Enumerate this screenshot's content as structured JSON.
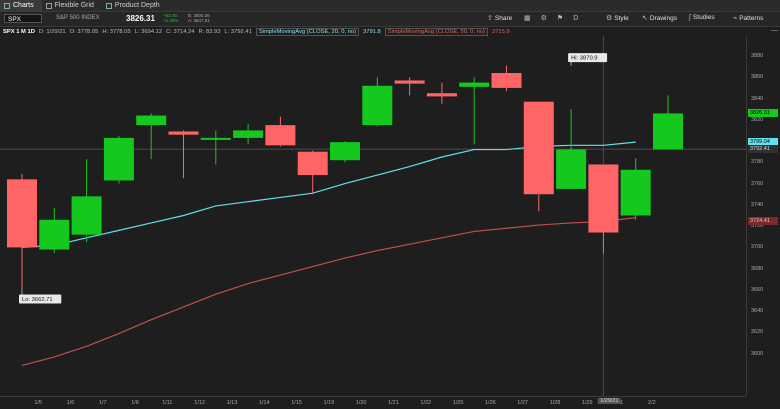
{
  "tabs": [
    {
      "label": "Charts",
      "active": true
    },
    {
      "label": "Flexible Grid",
      "active": false
    },
    {
      "label": "Product Depth",
      "active": false
    }
  ],
  "toolbar": {
    "symbol": "SPX",
    "symbol_name": "S&P 500 INDEX",
    "last": "3826.31",
    "change_abs": "+52.45",
    "change_pct": "+1.39%",
    "bid": "B: 3805.36",
    "ask": "A: 3847.61",
    "share_label": "Share",
    "aggregation_label": "D",
    "style_label": "Style",
    "drawings_label": "Drawings",
    "studies_label": "Studies",
    "patterns_label": "Patterns"
  },
  "study_line": {
    "symbol_period": "SPX 1 M 1D",
    "date": "D: 1/29/21",
    "open": "O: 3778.05",
    "high": "H: 3778.05",
    "low": "L: 3694.12",
    "close": "C: 3714.24",
    "range": "R: 83.93",
    "last": "L: 3792.41",
    "sma20_label": "SimpleMovingAvg (CLOSE, 20, 0, no)",
    "sma20_value": "3791.8",
    "sma50_label": "SimpleMovingAvg (CLOSE, 50, 0, no)",
    "sma50_value": "3715.9"
  },
  "price_badges": {
    "last": "3826.31",
    "sma20": "3799.04",
    "crosshair": "3792.41",
    "sma50": "3724.41"
  },
  "colors": {
    "up": "#14c81e",
    "down": "#ff6565",
    "sma20": "#5ee2ec",
    "sma50": "#c0504d"
  },
  "chart_data": {
    "type": "candlestick",
    "ylim": [
      3580,
      3880
    ],
    "yticks": [
      3600,
      3620,
      3640,
      3660,
      3680,
      3700,
      3720,
      3740,
      3760,
      3780,
      3800,
      3820,
      3840,
      3860,
      3880
    ],
    "xticks": [
      "1/5",
      "1/6",
      "1/7",
      "1/8",
      "1/11",
      "1/12",
      "1/13",
      "1/14",
      "1/15",
      "1/19",
      "1/20",
      "1/21",
      "1/22",
      "1/25",
      "1/26",
      "1/27",
      "1/28",
      "1/29",
      "2/1",
      "2/2"
    ],
    "candles": [
      {
        "o": 3764,
        "h": 3769,
        "l": 3662.71,
        "c": 3700
      },
      {
        "o": 3698,
        "h": 3737,
        "l": 3695,
        "c": 3726
      },
      {
        "o": 3712,
        "h": 3783,
        "l": 3705,
        "c": 3748
      },
      {
        "o": 3763,
        "h": 3805,
        "l": 3760,
        "c": 3803
      },
      {
        "o": 3815,
        "h": 3826,
        "l": 3783,
        "c": 3824
      },
      {
        "o": 3809,
        "h": 3810,
        "l": 3765,
        "c": 3806
      },
      {
        "o": 3803,
        "h": 3810,
        "l": 3778,
        "c": 3803
      },
      {
        "o": 3803,
        "h": 3816,
        "l": 3797,
        "c": 3810
      },
      {
        "o": 3815,
        "h": 3823,
        "l": 3795,
        "c": 3796
      },
      {
        "o": 3790,
        "h": 3791,
        "l": 3750,
        "c": 3768
      },
      {
        "o": 3782,
        "h": 3800,
        "l": 3780,
        "c": 3799
      },
      {
        "o": 3815,
        "h": 3860,
        "l": 3814,
        "c": 3852
      },
      {
        "o": 3857,
        "h": 3860,
        "l": 3843,
        "c": 3854
      },
      {
        "o": 3845,
        "h": 3855,
        "l": 3835,
        "c": 3842
      },
      {
        "o": 3851,
        "h": 3860,
        "l": 3797,
        "c": 3855
      },
      {
        "o": 3864,
        "h": 3870.9,
        "l": 3847,
        "c": 3850
      },
      {
        "o": 3837,
        "h": 3837,
        "l": 3734,
        "c": 3750
      },
      {
        "o": 3755,
        "h": 3830,
        "l": 3755,
        "c": 3792
      },
      {
        "o": 3778,
        "h": 3778,
        "l": 3694,
        "c": 3714
      },
      {
        "o": 3730,
        "h": 3784,
        "l": 3726,
        "c": 3773
      },
      {
        "o": 3792,
        "h": 3843,
        "l": 3792,
        "c": 3826
      }
    ],
    "sma20": [
      3700,
      3702,
      3709,
      3716,
      3723,
      3730,
      3739,
      3743,
      3747,
      3751,
      3760,
      3768,
      3776,
      3785,
      3792,
      3792,
      3795,
      3796,
      3796,
      3799
    ],
    "sma50": [
      3589,
      3597,
      3607,
      3619,
      3632,
      3644,
      3656,
      3666,
      3674,
      3682,
      3690,
      3697,
      3703,
      3709,
      3715,
      3718,
      3721,
      3723,
      3724.41,
      3728
    ],
    "annotations": {
      "hi": "Hi: 3870.9",
      "lo": "Lo: 3662.71"
    },
    "crosshair": {
      "price": 3792.41,
      "date": "1/29/21"
    }
  }
}
